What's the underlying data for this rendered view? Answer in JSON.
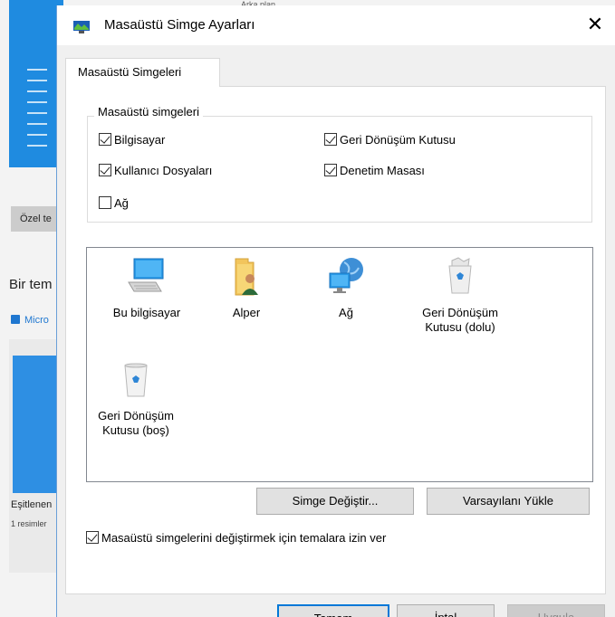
{
  "background": {
    "top_strip_text": "Arka plan",
    "ozel_button": "Özel te",
    "bir_heading": "Bir tem",
    "store_link": "Micro",
    "card_title": "Eşitlenen",
    "card_sub": "1 resimler"
  },
  "dialog": {
    "title": "Masaüstü Simge Ayarları",
    "close_glyph": "✕",
    "tab_label": "Masaüstü Simgeleri",
    "group_label": "Masaüstü simgeleri",
    "checkboxes": [
      {
        "label": "Bilgisayar",
        "checked": true
      },
      {
        "label": "Geri Dönüşüm Kutusu",
        "checked": true
      },
      {
        "label": "Kullanıcı Dosyaları",
        "checked": true
      },
      {
        "label": "Denetim Masası",
        "checked": true
      },
      {
        "label": "Ağ",
        "checked": false
      }
    ],
    "icons": [
      {
        "label": "Bu bilgisayar",
        "icon": "computer-icon"
      },
      {
        "label": "Alper",
        "icon": "user-folder-icon"
      },
      {
        "label": "Ağ",
        "icon": "network-icon"
      },
      {
        "label": "Geri Dönüşüm Kutusu (dolu)",
        "icon": "recycle-bin-full-icon"
      },
      {
        "label": "Geri Dönüşüm Kutusu (boş)",
        "icon": "recycle-bin-empty-icon"
      }
    ],
    "change_icon_button": "Simge Değiştir...",
    "restore_default_button": "Varsayılanı Yükle",
    "allow_themes_checkbox": {
      "label": "Masaüstü simgelerini değiştirmek için temalara izin ver",
      "checked": true
    },
    "ok_button": "Tamam",
    "cancel_button": "İptal",
    "apply_button": "Uygula"
  },
  "colors": {
    "accent": "#0078d7",
    "window_bg": "#f0f0f0",
    "bg_blue": "#1f8be0"
  }
}
